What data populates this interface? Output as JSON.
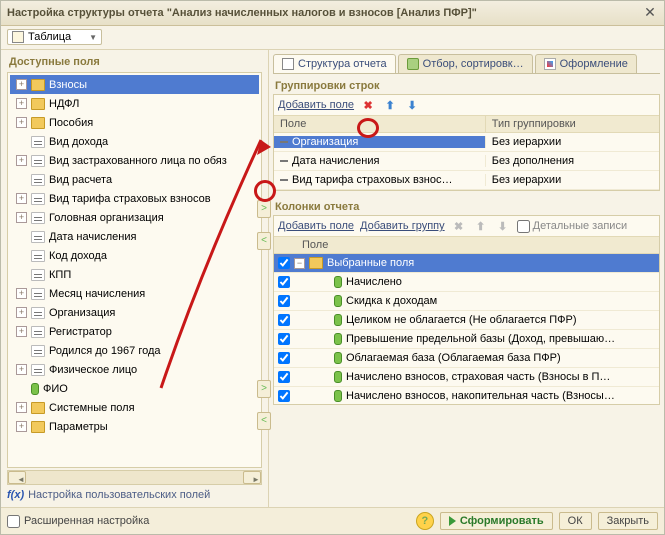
{
  "title": "Настройка структуры отчета \"Анализ начисленных налогов и взносов [Анализ ПФР]\"",
  "toolbar": {
    "view_label": "Таблица"
  },
  "left": {
    "title": "Доступные поля",
    "nodes": [
      {
        "exp": "+",
        "ico": "folder",
        "label": "Взносы",
        "sel": true
      },
      {
        "exp": "+",
        "ico": "folder",
        "label": "НДФЛ"
      },
      {
        "exp": "+",
        "ico": "folder",
        "label": "Пособия"
      },
      {
        "exp": "",
        "ico": "field",
        "label": "Вид дохода"
      },
      {
        "exp": "+",
        "ico": "field",
        "label": "Вид застрахованного лица по обяз"
      },
      {
        "exp": "",
        "ico": "field",
        "label": "Вид расчета"
      },
      {
        "exp": "+",
        "ico": "field",
        "label": "Вид тарифа страховых взносов"
      },
      {
        "exp": "+",
        "ico": "field",
        "label": "Головная организация"
      },
      {
        "exp": "",
        "ico": "field",
        "label": "Дата начисления"
      },
      {
        "exp": "",
        "ico": "field",
        "label": "Код дохода"
      },
      {
        "exp": "",
        "ico": "field",
        "label": "КПП"
      },
      {
        "exp": "+",
        "ico": "field",
        "label": "Месяц начисления"
      },
      {
        "exp": "+",
        "ico": "field",
        "label": "Организация"
      },
      {
        "exp": "+",
        "ico": "field",
        "label": "Регистратор"
      },
      {
        "exp": "",
        "ico": "field",
        "label": "Родился до 1967 года"
      },
      {
        "exp": "+",
        "ico": "field",
        "label": "Физическое лицо"
      },
      {
        "exp": "",
        "ico": "green",
        "label": "ФИО"
      },
      {
        "exp": "+",
        "ico": "folder",
        "label": "Системные поля"
      },
      {
        "exp": "+",
        "ico": "folder",
        "label": "Параметры"
      }
    ],
    "user_fields_label": "Настройка пользовательских полей"
  },
  "tabs": {
    "structure": "Структура отчета",
    "filter": "Отбор, сортировк…",
    "design": "Оформление"
  },
  "groupings": {
    "title": "Группировки строк",
    "add_label": "Добавить поле",
    "head_field": "Поле",
    "head_type": "Тип группировки",
    "rows": [
      {
        "field": "Организация",
        "type": "Без иерархии",
        "sel": true
      },
      {
        "field": "Дата начисления",
        "type": "Без дополнения"
      },
      {
        "field": "Вид тарифа страховых взнос…",
        "type": "Без иерархии"
      }
    ]
  },
  "columns": {
    "title": "Колонки отчета",
    "add_field": "Добавить поле",
    "add_group": "Добавить группу",
    "detail": "Детальные записи",
    "head": "Поле",
    "selected_header": "Выбранные поля",
    "rows": [
      "Начислено",
      "Скидка к доходам",
      "Целиком не облагается (Не облагается ПФР)",
      "Превышение предельной базы (Доход, превышаю…",
      "Облагаемая база (Облагаемая база ПФР)",
      "Начислено взносов, страховая часть (Взносы в П…",
      "Начислено взносов, накопительная часть (Взносы…"
    ]
  },
  "footer": {
    "advanced": "Расширенная настройка",
    "run": "Сформировать",
    "ok": "ОК",
    "close": "Закрыть"
  }
}
